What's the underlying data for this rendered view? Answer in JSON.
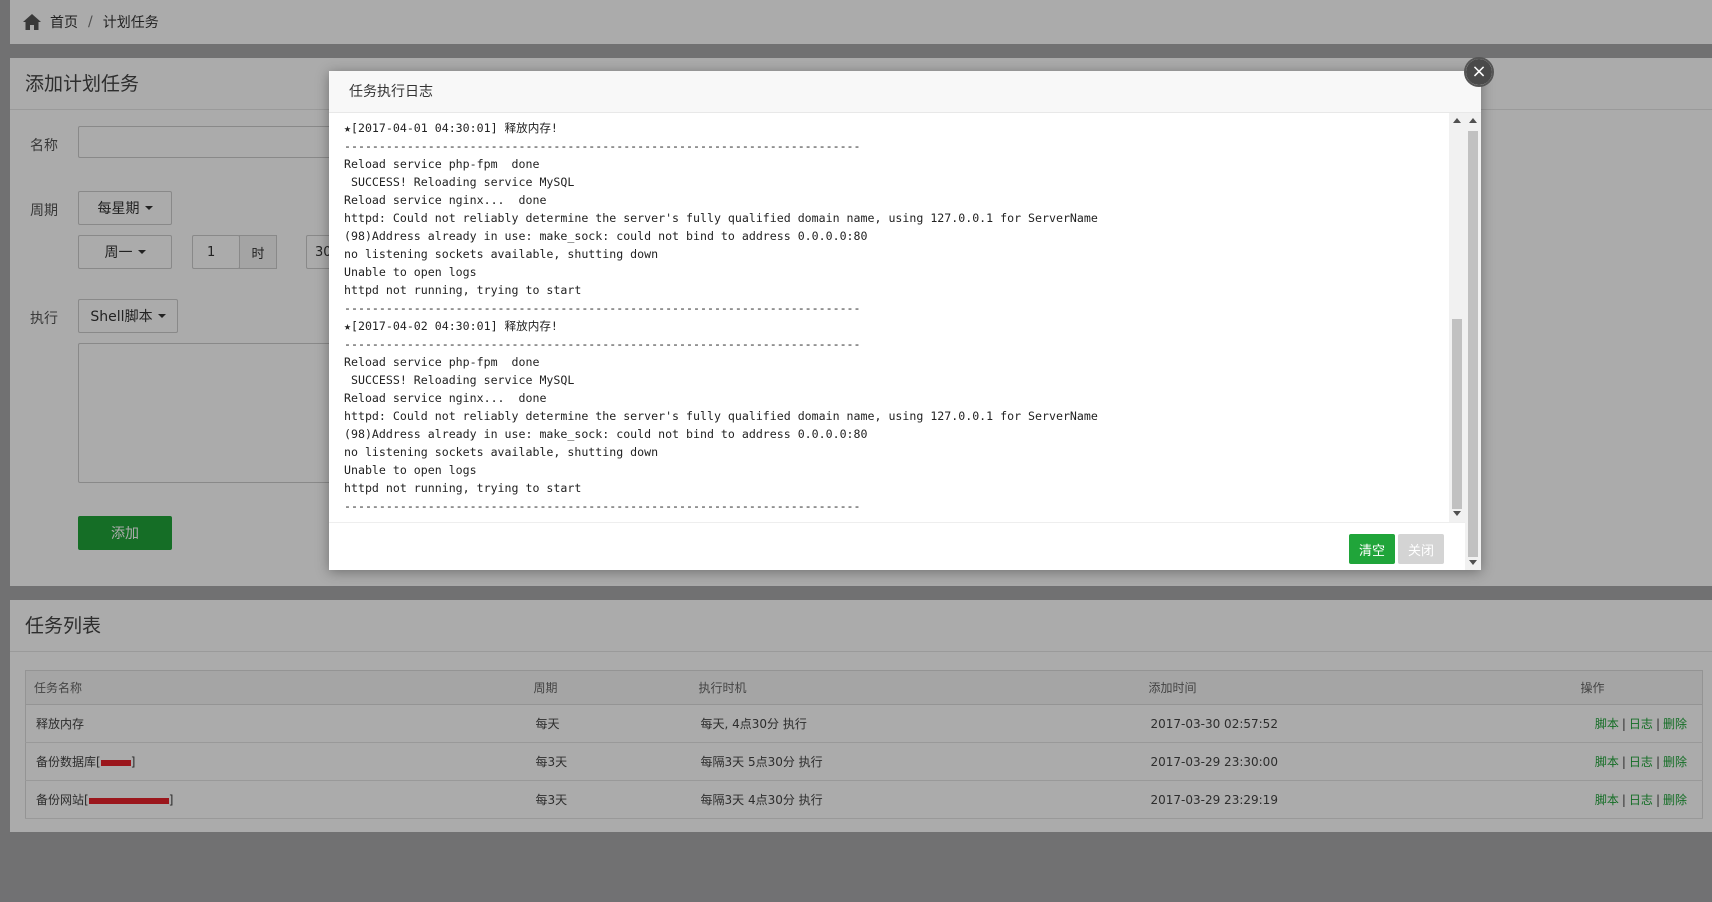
{
  "breadcrumb": {
    "home": "首页",
    "separator": "/",
    "current": "计划任务"
  },
  "add_panel": {
    "title": "添加计划任务",
    "name_label": "名称",
    "cycle_label": "周期",
    "cycle_value": "每星期",
    "weekday_value": "周一",
    "hour_value": "1",
    "hour_unit": "时",
    "minute_value": "30",
    "exec_label": "执行",
    "exec_type": "Shell脚本",
    "add_button": "添加"
  },
  "list_panel": {
    "title": "任务列表",
    "columns": [
      "任务名称",
      "周期",
      "执行时机",
      "添加时间",
      "操作"
    ],
    "rows": [
      {
        "name": "释放内存",
        "cycle": "每天",
        "timing": "每天, 4点30分 执行",
        "added": "2017-03-30 02:57:52"
      },
      {
        "name": "备份数据库[",
        "name_tail": "]",
        "cycle": "每3天",
        "timing": "每隔3天 5点30分 执行",
        "added": "2017-03-29 23:30:00"
      },
      {
        "name": "备份网站[",
        "name_tail": "]",
        "cycle": "每3天",
        "timing": "每隔3天 4点30分 执行",
        "added": "2017-03-29 23:29:19"
      }
    ],
    "ops": {
      "script": "脚本",
      "sep": "|",
      "log": "日志",
      "delete": "删除"
    }
  },
  "modal": {
    "title": "任务执行日志",
    "log_lines": [
      "★[2017-04-01 04:30:01] 释放内存!",
      "--------------------------------------------------------------------------",
      "Reload service php-fpm  done",
      " SUCCESS! Reloading service MySQL",
      "Reload service nginx...  done",
      "httpd: Could not reliably determine the server's fully qualified domain name, using 127.0.0.1 for ServerName",
      "(98)Address already in use: make_sock: could not bind to address 0.0.0.0:80",
      "no listening sockets available, shutting down",
      "Unable to open logs",
      "httpd not running, trying to start",
      "--------------------------------------------------------------------------",
      "★[2017-04-02 04:30:01] 释放内存!",
      "--------------------------------------------------------------------------",
      "Reload service php-fpm  done",
      " SUCCESS! Reloading service MySQL",
      "Reload service nginx...  done",
      "httpd: Could not reliably determine the server's fully qualified domain name, using 127.0.0.1 for ServerName",
      "(98)Address already in use: make_sock: could not bind to address 0.0.0.0:80",
      "no listening sockets available, shutting down",
      "Unable to open logs",
      "httpd not running, trying to start",
      "--------------------------------------------------------------------------"
    ],
    "clear_button": "清空",
    "close_button": "关闭",
    "close_icon": "×"
  },
  "colors": {
    "accent": "#20a53a",
    "redact": "#e8222a"
  }
}
